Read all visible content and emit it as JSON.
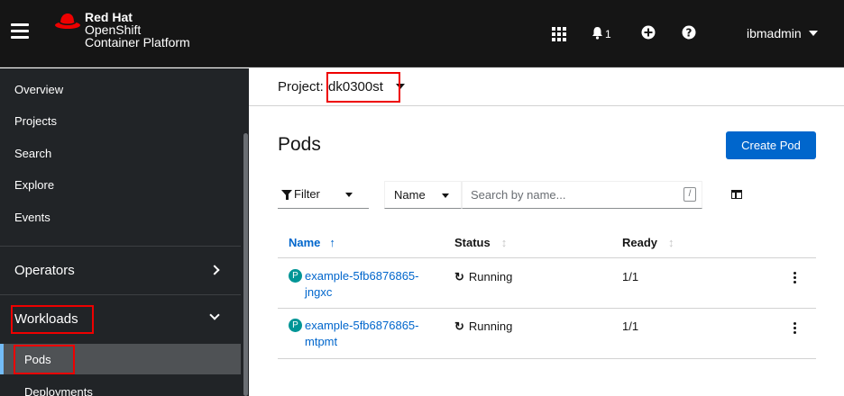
{
  "masthead": {
    "brand_line1": "Red Hat",
    "brand_line2": "OpenShift",
    "brand_line3": "Container Platform",
    "notification_count": "1",
    "user": "ibmadmin"
  },
  "sidebar": {
    "items": [
      {
        "label": "Overview"
      },
      {
        "label": "Projects"
      },
      {
        "label": "Search"
      },
      {
        "label": "Explore"
      },
      {
        "label": "Events"
      }
    ],
    "sections": [
      {
        "label": "Operators",
        "state": "collapsed"
      },
      {
        "label": "Workloads",
        "state": "expanded"
      }
    ],
    "workloads_items": [
      {
        "label": "Pods",
        "active": true
      },
      {
        "label": "Deployments"
      }
    ]
  },
  "project": {
    "label": "Project:",
    "value": "dk0300st"
  },
  "page": {
    "title": "Pods",
    "create_button": "Create Pod"
  },
  "filters": {
    "filter_label": "Filter",
    "attribute": "Name",
    "search_placeholder": "Search by name...",
    "shortcut_key": "/"
  },
  "table": {
    "columns": [
      "Name",
      "Status",
      "Ready"
    ],
    "rows": [
      {
        "badge": "P",
        "name_line1": "example-5fb6876865-",
        "name_line2": "jngxc",
        "status": "Running",
        "ready": "1/1"
      },
      {
        "badge": "P",
        "name_line1": "example-5fb6876865-",
        "name_line2": "mtpmt",
        "status": "Running",
        "ready": "1/1"
      }
    ]
  },
  "colors": {
    "masthead": "#151515",
    "sidebar": "#212427",
    "accent": "#0066cc",
    "pod_badge": "#009596",
    "highlight": "#ee0000"
  }
}
